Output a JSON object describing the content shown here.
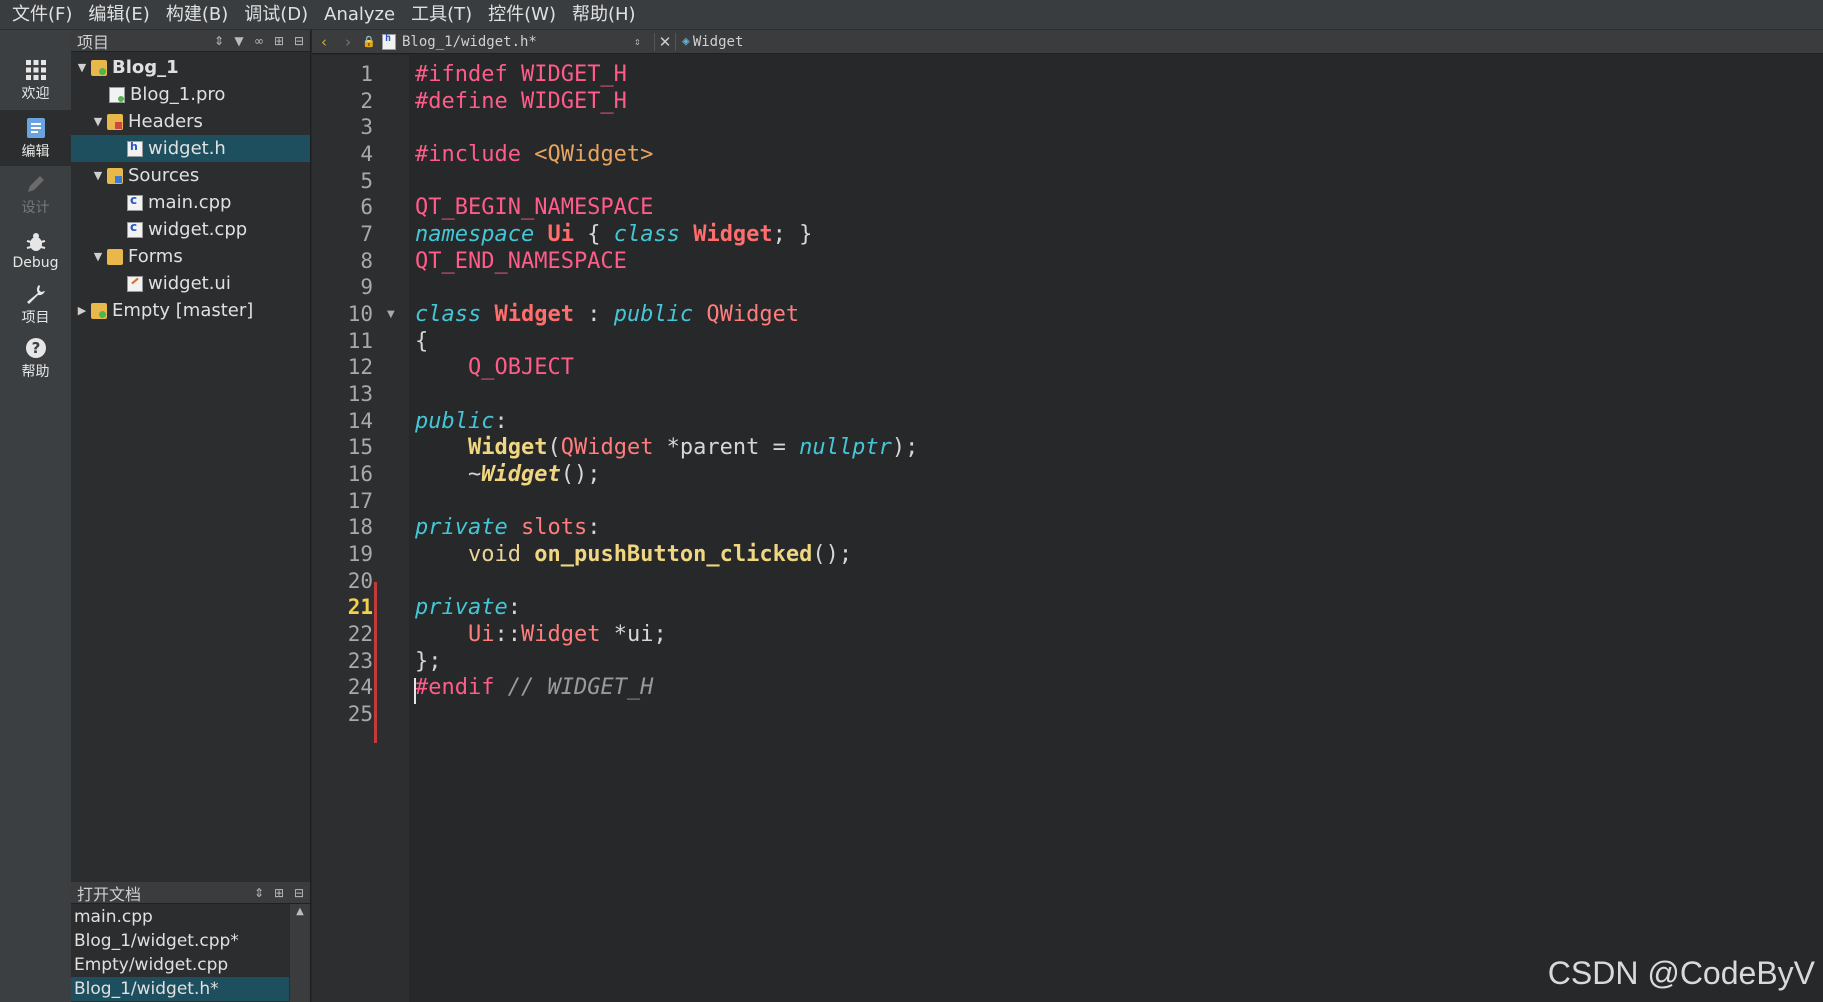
{
  "menu": [
    "文件(F)",
    "编辑(E)",
    "构建(B)",
    "调试(D)",
    "Analyze",
    "工具(T)",
    "控件(W)",
    "帮助(H)"
  ],
  "modes": [
    {
      "label": "欢迎",
      "icon": "grid-icon"
    },
    {
      "label": "编辑",
      "icon": "edit-doc-icon"
    },
    {
      "label": "设计",
      "icon": "pencil-icon"
    },
    {
      "label": "Debug",
      "icon": "bug-icon"
    },
    {
      "label": "项目",
      "icon": "wrench-icon"
    },
    {
      "label": "帮助",
      "icon": "help-icon"
    }
  ],
  "project_pane": {
    "title": "项目",
    "tree": [
      {
        "label": "Blog_1",
        "bold": true
      },
      {
        "label": "Blog_1.pro"
      },
      {
        "label": "Headers"
      },
      {
        "label": "widget.h",
        "selected": true
      },
      {
        "label": "Sources"
      },
      {
        "label": "main.cpp"
      },
      {
        "label": "widget.cpp"
      },
      {
        "label": "Forms"
      },
      {
        "label": "widget.ui"
      },
      {
        "label": "Empty [master]"
      }
    ]
  },
  "open_docs": {
    "title": "打开文档",
    "items": [
      "main.cpp",
      "Blog_1/widget.cpp*",
      "Empty/widget.cpp",
      "Blog_1/widget.h*"
    ],
    "selected_index": 3
  },
  "editor_toolbar": {
    "file": "Blog_1/widget.h*",
    "symbol": "Widget"
  },
  "editor": {
    "current_line": 21,
    "line_numbers": [
      "1",
      "2",
      "3",
      "4",
      "5",
      "6",
      "7",
      "8",
      "9",
      "10",
      "11",
      "12",
      "13",
      "14",
      "15",
      "16",
      "17",
      "18",
      "19",
      "20",
      "21",
      "22",
      "23",
      "24",
      "25"
    ],
    "tokens": {
      "l1a": "#ifndef",
      "l1b": " WIDGET_H",
      "l2a": "#define",
      "l2b": " WIDGET_H",
      "l4a": "#include",
      "l4b": " <QWidget>",
      "l6": "QT_BEGIN_NAMESPACE",
      "l7a": "namespace",
      "l7b": " Ui",
      "l7c": " { ",
      "l7d": "class",
      "l7e": " Widget",
      "l7f": "; }",
      "l8": "QT_END_NAMESPACE",
      "l10a": "class",
      "l10b": " Widget",
      "l10c": " : ",
      "l10d": "public",
      "l10e": " QWidget",
      "l11": "{",
      "l12": "    Q_OBJECT",
      "l14a": "public",
      "l14b": ":",
      "l15a": "    ",
      "l15b": "Widget",
      "l15c": "(",
      "l15d": "QWidget",
      "l15e": " *parent = ",
      "l15f": "nullptr",
      "l15g": ");",
      "l16a": "    ~",
      "l16b": "Widget",
      "l16c": "();",
      "l18a": "private",
      "l18b": " slots",
      "l18c": ":",
      "l19a": "    ",
      "l19b": "void",
      "l19c": " ",
      "l19d": "on_pushButton_clicked",
      "l19e": "();",
      "l21a": "private",
      "l21b": ":",
      "l22a": "    ",
      "l22b": "Ui",
      "l22c": "::",
      "l22d": "Widget",
      "l22e": " *ui;",
      "l23": "};",
      "l24a": "#endif",
      "l24b": " // WIDGET_H"
    }
  },
  "watermark": "CSDN @CodeByV"
}
